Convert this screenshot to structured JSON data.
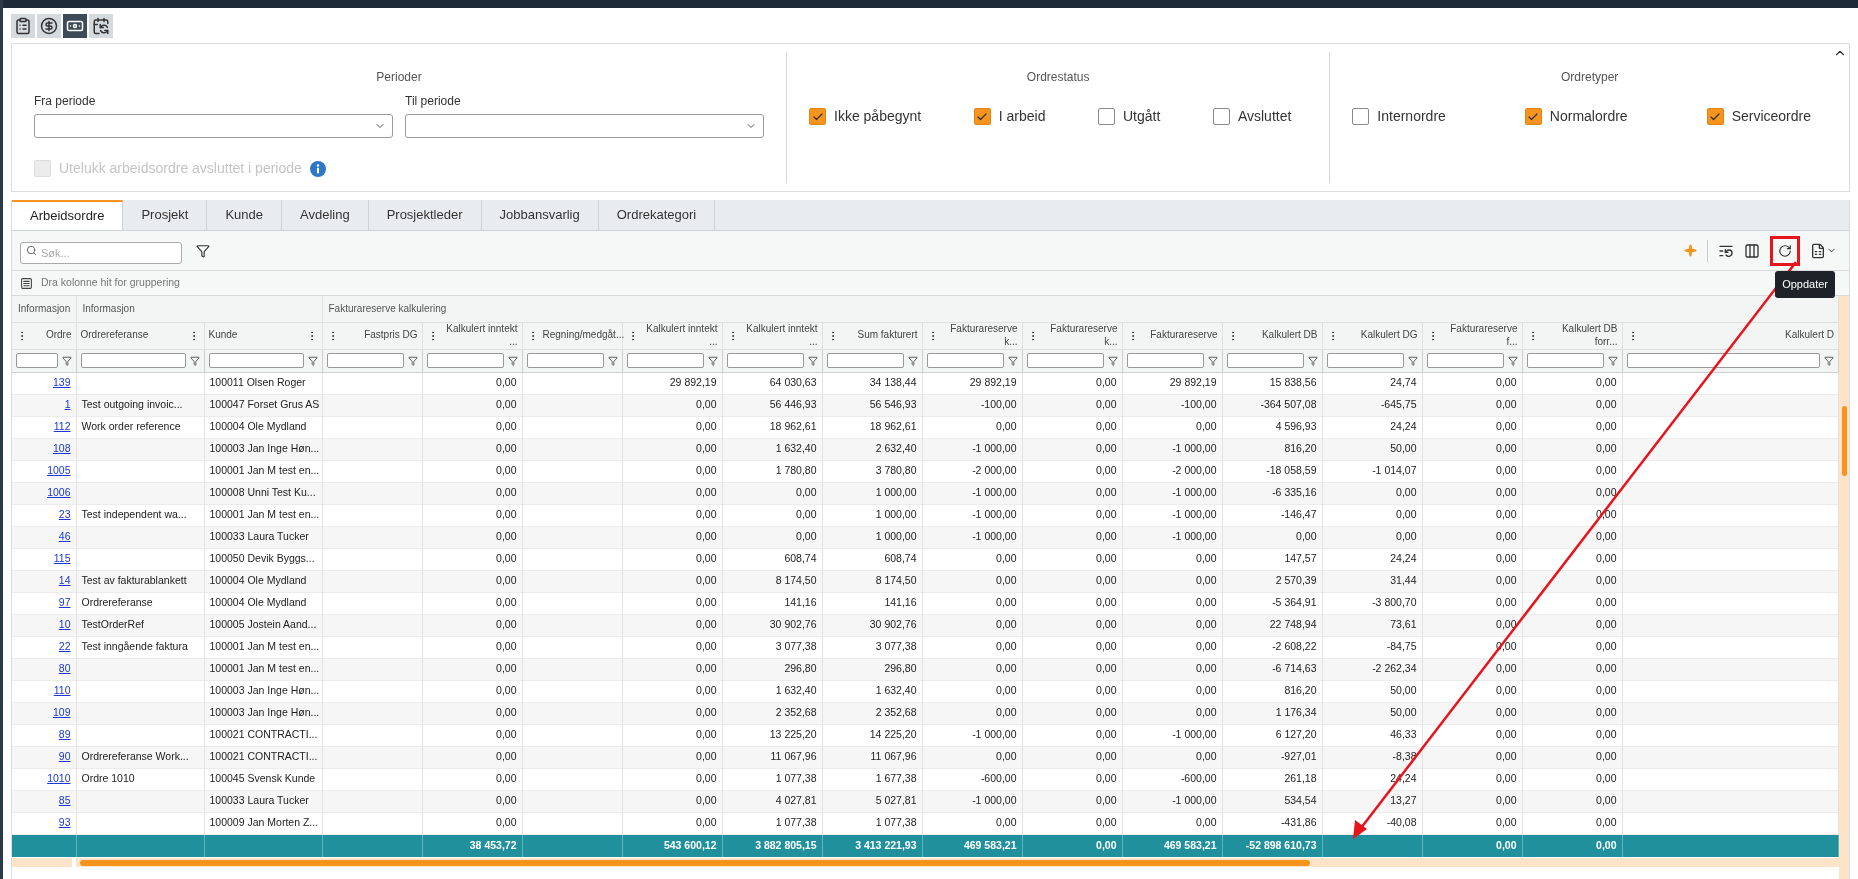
{
  "view_buttons": [
    {
      "selected": false
    },
    {
      "selected": false
    },
    {
      "selected": true
    },
    {
      "selected": false
    }
  ],
  "periods": {
    "title": "Perioder",
    "fields": [
      {
        "label": "Fra periode"
      },
      {
        "label": "Til periode"
      }
    ],
    "exclude": {
      "label": "Utelukk arbeidsordre avsluttet i periode",
      "checked": false,
      "disabled": true
    }
  },
  "order_status": {
    "title": "Ordrestatus",
    "options": [
      {
        "label": "Ikke påbegynt",
        "checked": true
      },
      {
        "label": "I arbeid",
        "checked": true
      },
      {
        "label": "Utgått",
        "checked": false
      },
      {
        "label": "Avsluttet",
        "checked": false
      }
    ]
  },
  "order_types": {
    "title": "Ordretyper",
    "options": [
      {
        "label": "Internordre",
        "checked": false
      },
      {
        "label": "Normalordre",
        "checked": true
      },
      {
        "label": "Serviceordre",
        "checked": true
      }
    ]
  },
  "tabs": [
    {
      "label": "Arbeidsordre",
      "selected": true
    },
    {
      "label": "Prosjekt",
      "selected": false
    },
    {
      "label": "Kunde",
      "selected": false
    },
    {
      "label": "Avdeling",
      "selected": false
    },
    {
      "label": "Prosjektleder",
      "selected": false
    },
    {
      "label": "Jobbansvarlig",
      "selected": false
    },
    {
      "label": "Ordrekategori",
      "selected": false
    }
  ],
  "search": {
    "placeholder": "Søk..."
  },
  "tooltip": "Oppdater",
  "grouping_hint": "Dra kolonne hit for gruppering",
  "table": {
    "groups": [
      {
        "label": "Informasjon"
      },
      {
        "label": "Informasjon"
      },
      {
        "label": "Fakturareserve kalkulering"
      }
    ],
    "columns": [
      {
        "label": "Ordre",
        "kind": "link"
      },
      {
        "label": "Ordrereferanse",
        "kind": "text"
      },
      {
        "label": "Kunde",
        "kind": "text"
      },
      {
        "label": "Fastpris DG",
        "kind": "number"
      },
      {
        "label": "Kalkulert inntekt ...",
        "kind": "number"
      },
      {
        "label": "Regning/medgåt...",
        "kind": "number"
      },
      {
        "label": "Kalkulert inntekt ...",
        "kind": "number"
      },
      {
        "label": "Kalkulert inntekt ...",
        "kind": "number"
      },
      {
        "label": "Sum fakturert",
        "kind": "number"
      },
      {
        "label": "Fakturareserve k...",
        "kind": "number"
      },
      {
        "label": "Fakturareserve k...",
        "kind": "number"
      },
      {
        "label": "Fakturareserve",
        "kind": "number"
      },
      {
        "label": "Kalkulert DB",
        "kind": "number"
      },
      {
        "label": "Kalkulert DG",
        "kind": "number"
      },
      {
        "label": "Fakturareserve f...",
        "kind": "number"
      },
      {
        "label": "Kalkulert DB forr...",
        "kind": "number"
      },
      {
        "label": "Kalkulert D",
        "kind": "number"
      }
    ],
    "rows": [
      [
        "139",
        null,
        "100011 Olsen Roger",
        null,
        "0,00",
        null,
        "29 892,19",
        "64 030,63",
        "34 138,44",
        "29 892,19",
        "0,00",
        "29 892,19",
        "15 838,56",
        "24,74",
        "0,00",
        "0,00",
        null
      ],
      [
        "1",
        "Test outgoing invoic...",
        "100047 Forset Grus AS",
        null,
        "0,00",
        null,
        "0,00",
        "56 446,93",
        "56 546,93",
        "-100,00",
        "0,00",
        "-100,00",
        "-364 507,08",
        "-645,75",
        "0,00",
        "0,00",
        null
      ],
      [
        "112",
        "Work order reference",
        "100004 Ole Mydland",
        null,
        "0,00",
        null,
        "0,00",
        "18 962,61",
        "18 962,61",
        "0,00",
        "0,00",
        "0,00",
        "4 596,93",
        "24,24",
        "0,00",
        "0,00",
        null
      ],
      [
        "108",
        null,
        "100003 Jan Inge Høn...",
        null,
        "0,00",
        null,
        "0,00",
        "1 632,40",
        "2 632,40",
        "-1 000,00",
        "0,00",
        "-1 000,00",
        "816,20",
        "50,00",
        "0,00",
        "0,00",
        null
      ],
      [
        "1005",
        null,
        "100001 Jan M test en...",
        null,
        "0,00",
        null,
        "0,00",
        "1 780,80",
        "3 780,80",
        "-2 000,00",
        "0,00",
        "-2 000,00",
        "-18 058,59",
        "-1 014,07",
        "0,00",
        "0,00",
        null
      ],
      [
        "1006",
        null,
        "100008 Unni Test Ku...",
        null,
        "0,00",
        null,
        "0,00",
        "0,00",
        "1 000,00",
        "-1 000,00",
        "0,00",
        "-1 000,00",
        "-6 335,16",
        "0,00",
        "0,00",
        "0,00",
        null
      ],
      [
        "23",
        "Test independent wa...",
        "100001 Jan M test en...",
        null,
        "0,00",
        null,
        "0,00",
        "0,00",
        "1 000,00",
        "-1 000,00",
        "0,00",
        "-1 000,00",
        "-146,47",
        "0,00",
        "0,00",
        "0,00",
        null
      ],
      [
        "46",
        null,
        "100033 Laura Tucker",
        null,
        "0,00",
        null,
        "0,00",
        "0,00",
        "1 000,00",
        "-1 000,00",
        "0,00",
        "-1 000,00",
        "0,00",
        "0,00",
        "0,00",
        "0,00",
        null
      ],
      [
        "115",
        null,
        "100050 Devik Byggs...",
        null,
        "0,00",
        null,
        "0,00",
        "608,74",
        "608,74",
        "0,00",
        "0,00",
        "0,00",
        "147,57",
        "24,24",
        "0,00",
        "0,00",
        null
      ],
      [
        "14",
        "Test av fakturablankett",
        "100004 Ole Mydland",
        null,
        "0,00",
        null,
        "0,00",
        "8 174,50",
        "8 174,50",
        "0,00",
        "0,00",
        "0,00",
        "2 570,39",
        "31,44",
        "0,00",
        "0,00",
        null
      ],
      [
        "97",
        "Ordrereferanse",
        "100004 Ole Mydland",
        null,
        "0,00",
        null,
        "0,00",
        "141,16",
        "141,16",
        "0,00",
        "0,00",
        "0,00",
        "-5 364,91",
        "-3 800,70",
        "0,00",
        "0,00",
        null
      ],
      [
        "10",
        "TestOrderRef",
        "100005 Jostein Aand...",
        null,
        "0,00",
        null,
        "0,00",
        "30 902,76",
        "30 902,76",
        "0,00",
        "0,00",
        "0,00",
        "22 748,94",
        "73,61",
        "0,00",
        "0,00",
        null
      ],
      [
        "22",
        "Test inngående faktura",
        "100001 Jan M test en...",
        null,
        "0,00",
        null,
        "0,00",
        "3 077,38",
        "3 077,38",
        "0,00",
        "0,00",
        "0,00",
        "-2 608,22",
        "-84,75",
        "0,00",
        "0,00",
        null
      ],
      [
        "80",
        null,
        "100001 Jan M test en...",
        null,
        "0,00",
        null,
        "0,00",
        "296,80",
        "296,80",
        "0,00",
        "0,00",
        "0,00",
        "-6 714,63",
        "-2 262,34",
        "0,00",
        "0,00",
        null
      ],
      [
        "110",
        null,
        "100003 Jan Inge Høn...",
        null,
        "0,00",
        null,
        "0,00",
        "1 632,40",
        "1 632,40",
        "0,00",
        "0,00",
        "0,00",
        "816,20",
        "50,00",
        "0,00",
        "0,00",
        null
      ],
      [
        "109",
        null,
        "100003 Jan Inge Høn...",
        null,
        "0,00",
        null,
        "0,00",
        "2 352,68",
        "2 352,68",
        "0,00",
        "0,00",
        "0,00",
        "1 176,34",
        "50,00",
        "0,00",
        "0,00",
        null
      ],
      [
        "89",
        null,
        "100021 CONTRACTI...",
        null,
        "0,00",
        null,
        "0,00",
        "13 225,20",
        "14 225,20",
        "-1 000,00",
        "0,00",
        "-1 000,00",
        "6 127,20",
        "46,33",
        "0,00",
        "0,00",
        null
      ],
      [
        "90",
        "Ordrereferanse Work...",
        "100021 CONTRACTI...",
        null,
        "0,00",
        null,
        "0,00",
        "11 067,96",
        "11 067,96",
        "0,00",
        "0,00",
        "0,00",
        "-927,01",
        "-8,38",
        "0,00",
        "0,00",
        null
      ],
      [
        "1010",
        "Ordre 1010",
        "100045 Svensk Kunde",
        null,
        "0,00",
        null,
        "0,00",
        "1 077,38",
        "1 677,38",
        "-600,00",
        "0,00",
        "-600,00",
        "261,18",
        "24,24",
        "0,00",
        "0,00",
        null
      ],
      [
        "85",
        null,
        "100033 Laura Tucker",
        null,
        "0,00",
        null,
        "0,00",
        "4 027,81",
        "5 027,81",
        "-1 000,00",
        "0,00",
        "-1 000,00",
        "534,54",
        "13,27",
        "0,00",
        "0,00",
        null
      ],
      [
        "93",
        null,
        "100009 Jan Morten Z...",
        null,
        "0,00",
        null,
        "0,00",
        "1 077,38",
        "1 077,38",
        "0,00",
        "0,00",
        "0,00",
        "-431,86",
        "-40,08",
        "0,00",
        "0,00",
        null
      ]
    ],
    "totals": {
      "4": "38 453,72",
      "6": "543 600,12",
      "7": "3 882 805,15",
      "8": "3 413 221,93",
      "9": "469 583,21",
      "10": "0,00",
      "11": "469 583,21",
      "12": "-52 898 610,73",
      "14": "0,00",
      "15": "0,00"
    }
  }
}
